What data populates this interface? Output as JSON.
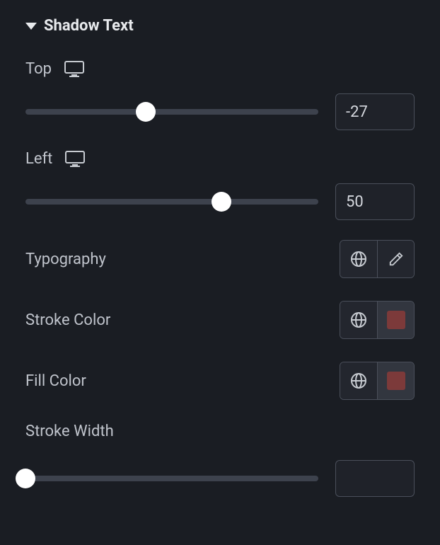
{
  "section": {
    "title": "Shadow Text"
  },
  "top": {
    "label": "Top",
    "value": "-27",
    "percent": 41
  },
  "left": {
    "label": "Left",
    "value": "50",
    "percent": 67
  },
  "typography": {
    "label": "Typography"
  },
  "strokeColor": {
    "label": "Stroke Color",
    "color": "#7c3a3a"
  },
  "fillColor": {
    "label": "Fill Color",
    "color": "#7c3a3a"
  },
  "strokeWidth": {
    "label": "Stroke Width",
    "value": "",
    "percent": 0
  }
}
